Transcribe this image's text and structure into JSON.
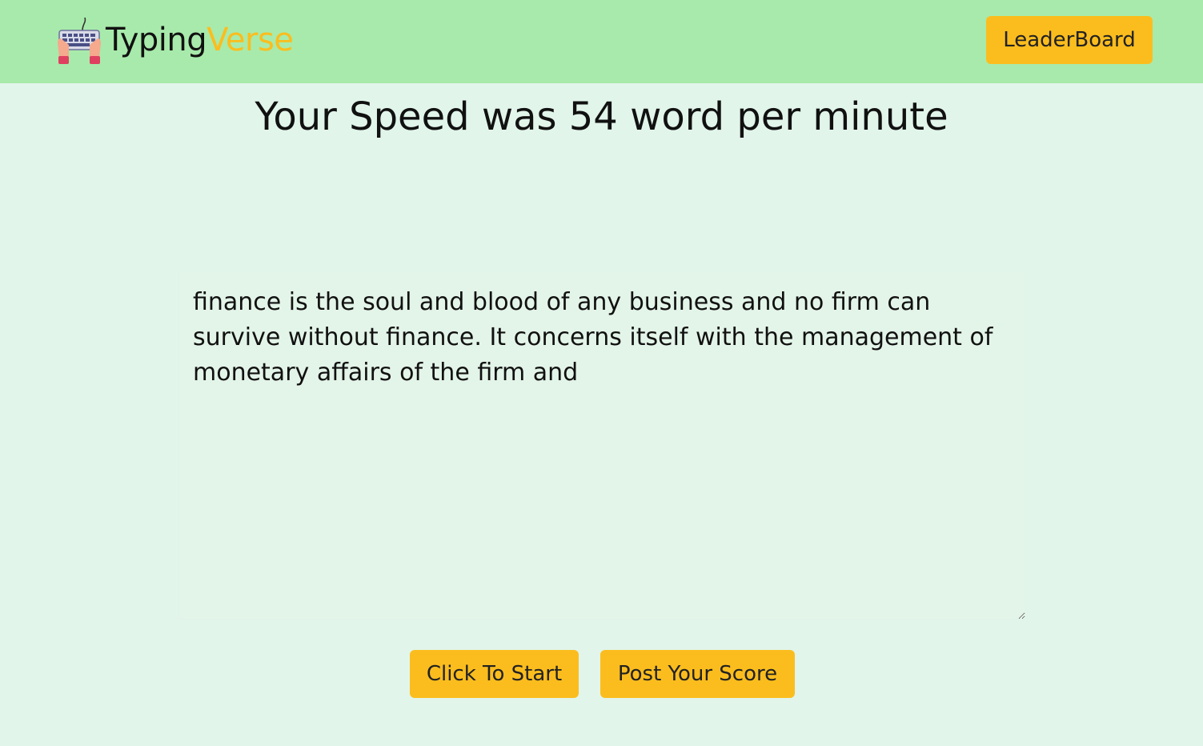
{
  "header": {
    "brand_part1": "Typing",
    "brand_part2": "Verse",
    "leaderboard_label": "LeaderBoard",
    "logo_icon": "keyboard-hands-icon"
  },
  "main": {
    "speed_text": "Your Speed was 54 word per minute",
    "typing_text": "finance is the soul and blood of any business and no firm can survive without finance. It concerns itself with the management of monetary affairs of the firm and"
  },
  "actions": {
    "start_label": "Click To Start",
    "post_label": "Post Your Score"
  },
  "colors": {
    "navbar": "#a8eaab",
    "background": "#e1f5ea",
    "accent": "#fbbd1e"
  }
}
